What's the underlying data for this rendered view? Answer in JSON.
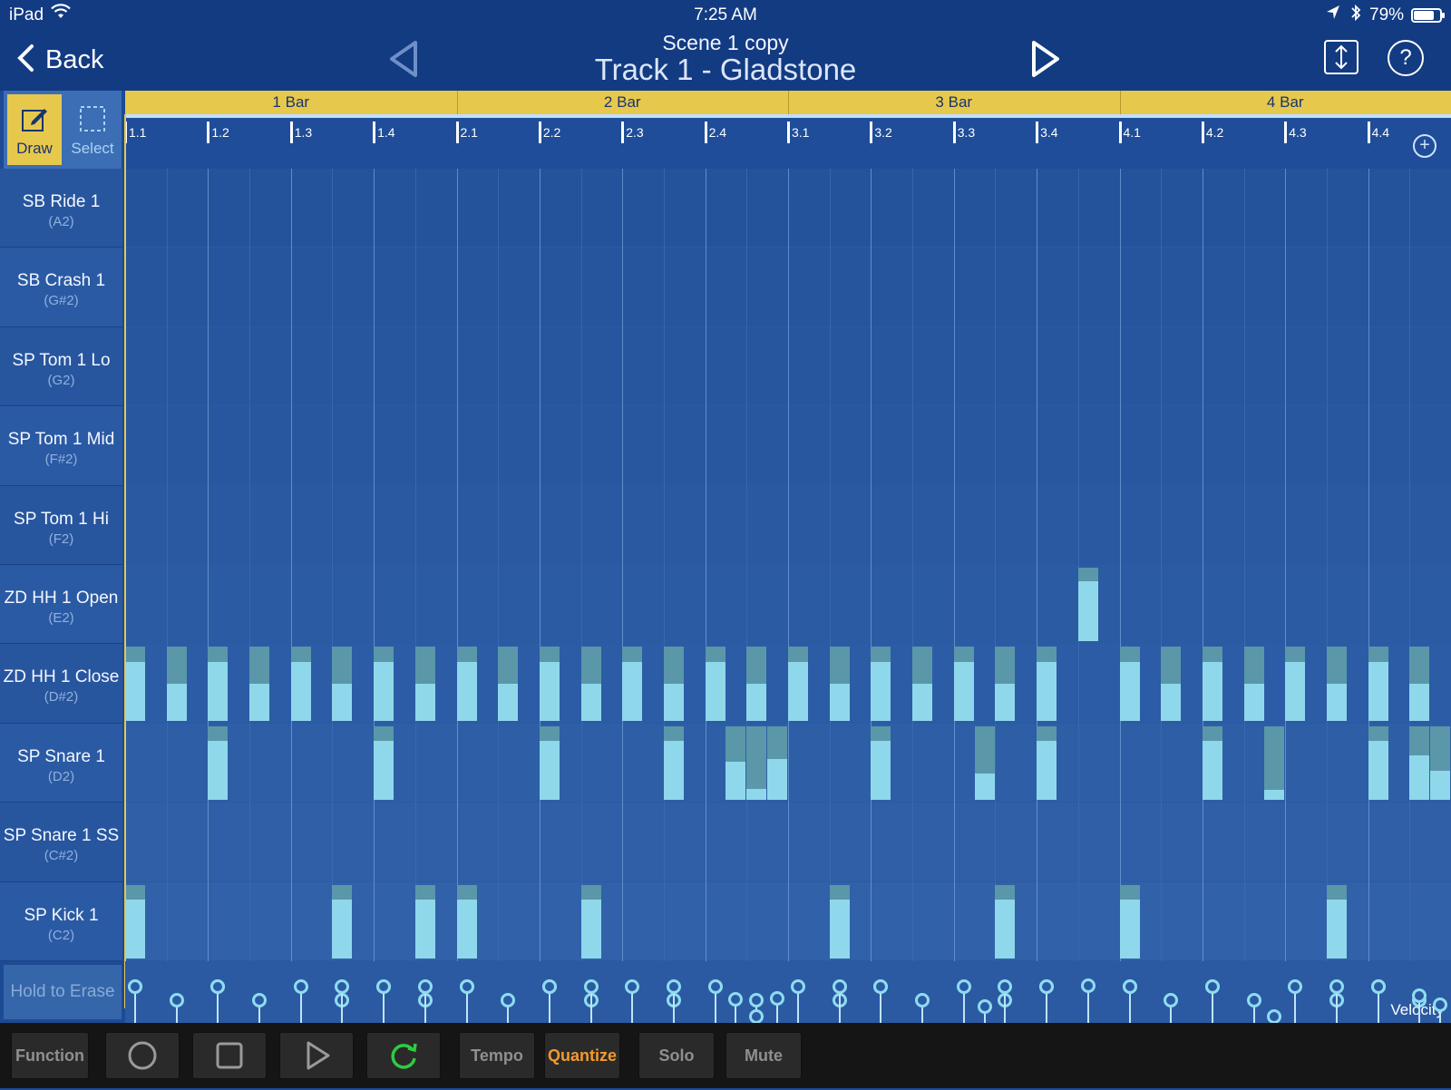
{
  "status": {
    "device": "iPad",
    "time": "7:25 AM",
    "battery_pct": "79%",
    "battery_level": 0.79
  },
  "nav": {
    "back_label": "Back",
    "scene_title": "Scene  1 copy",
    "track_title": "Track 1 - Gladstone",
    "help_label": "?"
  },
  "tools": {
    "draw_label": "Draw",
    "select_label": "Select",
    "active": "draw"
  },
  "bars": [
    "1 Bar",
    "2 Bar",
    "3 Bar",
    "4 Bar"
  ],
  "ticks": [
    "1.1",
    "1.2",
    "1.3",
    "1.4",
    "2.1",
    "2.2",
    "2.3",
    "2.4",
    "3.1",
    "3.2",
    "3.3",
    "3.4",
    "4.1",
    "4.2",
    "4.3",
    "4.4"
  ],
  "add_label": "+",
  "lanes": [
    {
      "name": "SB Ride 1",
      "note": "(A2)"
    },
    {
      "name": "SB Crash 1",
      "note": "(G#2)"
    },
    {
      "name": "SP Tom 1 Lo",
      "note": "(G2)"
    },
    {
      "name": "SP Tom 1 Mid",
      "note": "(F#2)"
    },
    {
      "name": "SP Tom 1 Hi",
      "note": "(F2)"
    },
    {
      "name": "ZD HH 1 Open",
      "note": "(E2)"
    },
    {
      "name": "ZD HH 1 Close",
      "note": "(D#2)"
    },
    {
      "name": "SP Snare 1",
      "note": "(D2)"
    },
    {
      "name": "SP Snare 1 SS",
      "note": "(C#2)"
    },
    {
      "name": "SP Kick 1",
      "note": "(C2)"
    }
  ],
  "notes": [
    {
      "lane": 5,
      "step": 46,
      "vel": 0.82
    },
    {
      "lane": 6,
      "step": 0,
      "vel": 0.8
    },
    {
      "lane": 6,
      "step": 2,
      "vel": 0.5
    },
    {
      "lane": 6,
      "step": 4,
      "vel": 0.8
    },
    {
      "lane": 6,
      "step": 6,
      "vel": 0.5
    },
    {
      "lane": 6,
      "step": 8,
      "vel": 0.8
    },
    {
      "lane": 6,
      "step": 10,
      "vel": 0.5
    },
    {
      "lane": 6,
      "step": 12,
      "vel": 0.8
    },
    {
      "lane": 6,
      "step": 14,
      "vel": 0.5
    },
    {
      "lane": 6,
      "step": 16,
      "vel": 0.8
    },
    {
      "lane": 6,
      "step": 18,
      "vel": 0.5
    },
    {
      "lane": 6,
      "step": 20,
      "vel": 0.8
    },
    {
      "lane": 6,
      "step": 22,
      "vel": 0.5
    },
    {
      "lane": 6,
      "step": 24,
      "vel": 0.8
    },
    {
      "lane": 6,
      "step": 26,
      "vel": 0.5
    },
    {
      "lane": 6,
      "step": 28,
      "vel": 0.8
    },
    {
      "lane": 6,
      "step": 30,
      "vel": 0.5
    },
    {
      "lane": 6,
      "step": 32,
      "vel": 0.8
    },
    {
      "lane": 6,
      "step": 34,
      "vel": 0.5
    },
    {
      "lane": 6,
      "step": 36,
      "vel": 0.8
    },
    {
      "lane": 6,
      "step": 38,
      "vel": 0.5
    },
    {
      "lane": 6,
      "step": 40,
      "vel": 0.8
    },
    {
      "lane": 6,
      "step": 42,
      "vel": 0.5
    },
    {
      "lane": 6,
      "step": 44,
      "vel": 0.8
    },
    {
      "lane": 6,
      "step": 48,
      "vel": 0.8
    },
    {
      "lane": 6,
      "step": 50,
      "vel": 0.5
    },
    {
      "lane": 6,
      "step": 52,
      "vel": 0.8
    },
    {
      "lane": 6,
      "step": 54,
      "vel": 0.5
    },
    {
      "lane": 6,
      "step": 56,
      "vel": 0.8
    },
    {
      "lane": 6,
      "step": 58,
      "vel": 0.5
    },
    {
      "lane": 6,
      "step": 60,
      "vel": 0.8
    },
    {
      "lane": 6,
      "step": 62,
      "vel": 0.5
    },
    {
      "lane": 7,
      "step": 4,
      "vel": 0.8
    },
    {
      "lane": 7,
      "step": 12,
      "vel": 0.8
    },
    {
      "lane": 7,
      "step": 20,
      "vel": 0.8
    },
    {
      "lane": 7,
      "step": 26,
      "vel": 0.8
    },
    {
      "lane": 7,
      "step": 29,
      "vel": 0.52
    },
    {
      "lane": 7,
      "step": 30,
      "vel": 0.15
    },
    {
      "lane": 7,
      "step": 31,
      "vel": 0.55
    },
    {
      "lane": 7,
      "step": 36,
      "vel": 0.8
    },
    {
      "lane": 7,
      "step": 41,
      "vel": 0.36
    },
    {
      "lane": 7,
      "step": 44,
      "vel": 0.8
    },
    {
      "lane": 7,
      "step": 52,
      "vel": 0.8
    },
    {
      "lane": 7,
      "step": 55,
      "vel": 0.14
    },
    {
      "lane": 7,
      "step": 60,
      "vel": 0.8
    },
    {
      "lane": 7,
      "step": 62,
      "vel": 0.6
    },
    {
      "lane": 7,
      "step": 63,
      "vel": 0.4
    },
    {
      "lane": 9,
      "step": 0,
      "vel": 0.8
    },
    {
      "lane": 9,
      "step": 10,
      "vel": 0.8
    },
    {
      "lane": 9,
      "step": 14,
      "vel": 0.8
    },
    {
      "lane": 9,
      "step": 16,
      "vel": 0.8
    },
    {
      "lane": 9,
      "step": 22,
      "vel": 0.8
    },
    {
      "lane": 9,
      "step": 34,
      "vel": 0.8
    },
    {
      "lane": 9,
      "step": 42,
      "vel": 0.8
    },
    {
      "lane": 9,
      "step": 48,
      "vel": 0.8
    },
    {
      "lane": 9,
      "step": 58,
      "vel": 0.8
    }
  ],
  "hold_to_erase": "Hold to Erase",
  "velocity_label": "Velocity",
  "toolbar": {
    "function": "Function",
    "tempo": "Tempo",
    "quantize": "Quantize",
    "solo": "Solo",
    "mute": "Mute"
  },
  "colors": {
    "accent": "#e6c84d",
    "note": "#8fd8ec",
    "quantize_active": "#f29a2e",
    "loop_green": "#2ecc40"
  }
}
